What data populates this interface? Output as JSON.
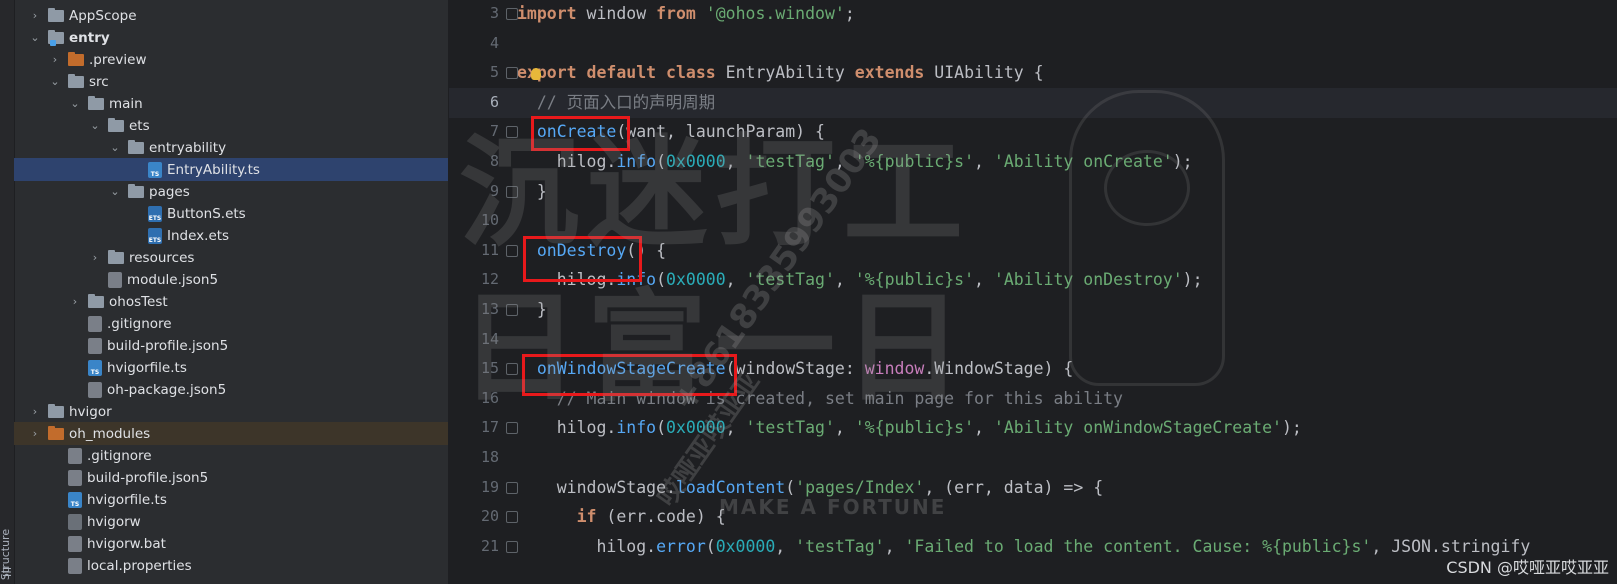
{
  "side_stripe": {
    "label": "Structure",
    "icon": "structure-icon"
  },
  "tree": [
    {
      "label": "AppScope",
      "kind": "folder",
      "depth": 1,
      "expand": "collapsed"
    },
    {
      "label": "entry",
      "kind": "folder-mod",
      "depth": 1,
      "expand": "expanded",
      "bold": true
    },
    {
      "label": ".preview",
      "kind": "folder-orange",
      "depth": 2,
      "expand": "collapsed"
    },
    {
      "label": "src",
      "kind": "folder",
      "depth": 2,
      "expand": "expanded"
    },
    {
      "label": "main",
      "kind": "folder",
      "depth": 3,
      "expand": "expanded"
    },
    {
      "label": "ets",
      "kind": "folder",
      "depth": 4,
      "expand": "expanded"
    },
    {
      "label": "entryability",
      "kind": "folder",
      "depth": 5,
      "expand": "expanded"
    },
    {
      "label": "EntryAbility.ts",
      "kind": "ts",
      "depth": 6,
      "expand": "none",
      "selected": true
    },
    {
      "label": "pages",
      "kind": "folder",
      "depth": 5,
      "expand": "expanded"
    },
    {
      "label": "ButtonS.ets",
      "kind": "ets",
      "depth": 6,
      "expand": "none"
    },
    {
      "label": "Index.ets",
      "kind": "ets",
      "depth": 6,
      "expand": "none"
    },
    {
      "label": "resources",
      "kind": "folder",
      "depth": 4,
      "expand": "collapsed"
    },
    {
      "label": "module.json5",
      "kind": "json",
      "depth": 4,
      "expand": "none"
    },
    {
      "label": "ohosTest",
      "kind": "folder",
      "depth": 3,
      "expand": "collapsed"
    },
    {
      "label": ".gitignore",
      "kind": "git",
      "depth": 3,
      "expand": "none"
    },
    {
      "label": "build-profile.json5",
      "kind": "json",
      "depth": 3,
      "expand": "none"
    },
    {
      "label": "hvigorfile.ts",
      "kind": "ts",
      "depth": 3,
      "expand": "none"
    },
    {
      "label": "oh-package.json5",
      "kind": "json",
      "depth": 3,
      "expand": "none"
    },
    {
      "label": "hvigor",
      "kind": "folder",
      "depth": 1,
      "expand": "collapsed"
    },
    {
      "label": "oh_modules",
      "kind": "folder-orange",
      "depth": 1,
      "expand": "collapsed",
      "highlight": true
    },
    {
      "label": ".gitignore",
      "kind": "git",
      "depth": 2,
      "expand": "none"
    },
    {
      "label": "build-profile.json5",
      "kind": "json",
      "depth": 2,
      "expand": "none"
    },
    {
      "label": "hvigorfile.ts",
      "kind": "ts",
      "depth": 2,
      "expand": "none"
    },
    {
      "label": "hvigorw",
      "kind": "sh",
      "depth": 2,
      "expand": "none"
    },
    {
      "label": "hvigorw.bat",
      "kind": "json",
      "depth": 2,
      "expand": "none"
    },
    {
      "label": "local.properties",
      "kind": "json",
      "depth": 2,
      "expand": "none"
    }
  ],
  "code": [
    {
      "n": "3",
      "t": [
        [
          "kw",
          "import"
        ],
        [
          "p",
          " window "
        ],
        [
          "kw",
          "from"
        ],
        [
          "p",
          " "
        ],
        [
          "str",
          "'@ohos.window'"
        ],
        [
          "p",
          ";"
        ]
      ]
    },
    {
      "n": "4",
      "t": []
    },
    {
      "n": "5",
      "t": [
        [
          "kw",
          "export"
        ],
        [
          "p",
          " "
        ],
        [
          "kw",
          "default"
        ],
        [
          "p",
          " "
        ],
        [
          "kw",
          "class"
        ],
        [
          "p",
          " "
        ],
        [
          "cls",
          "EntryAbility"
        ],
        [
          "p",
          " "
        ],
        [
          "kw",
          "extends"
        ],
        [
          "p",
          " "
        ],
        [
          "cls",
          "UIAbility"
        ],
        [
          "p",
          " {"
        ]
      ]
    },
    {
      "n": "6",
      "t": [
        [
          "p",
          "  "
        ],
        [
          "cmt",
          "// 页面入口的声明周期"
        ]
      ],
      "current": true
    },
    {
      "n": "7",
      "t": [
        [
          "p",
          "  "
        ],
        [
          "fn",
          "onCreate"
        ],
        [
          "p",
          "(want, launchParam) {"
        ]
      ]
    },
    {
      "n": "8",
      "t": [
        [
          "p",
          "    hilog."
        ],
        [
          "fn",
          "info"
        ],
        [
          "p",
          "("
        ],
        [
          "num",
          "0x0000"
        ],
        [
          "p",
          ", "
        ],
        [
          "str",
          "'testTag'"
        ],
        [
          "p",
          ", "
        ],
        [
          "str",
          "'%{public}s'"
        ],
        [
          "p",
          ", "
        ],
        [
          "str",
          "'Ability onCreate'"
        ],
        [
          "p",
          ");"
        ]
      ]
    },
    {
      "n": "9",
      "t": [
        [
          "p",
          "  }"
        ]
      ]
    },
    {
      "n": "10",
      "t": []
    },
    {
      "n": "11",
      "t": [
        [
          "p",
          "  "
        ],
        [
          "fn",
          "onDestroy"
        ],
        [
          "p",
          "() {"
        ]
      ]
    },
    {
      "n": "12",
      "t": [
        [
          "p",
          "    hilog."
        ],
        [
          "fn",
          "info"
        ],
        [
          "p",
          "("
        ],
        [
          "num",
          "0x0000"
        ],
        [
          "p",
          ", "
        ],
        [
          "str",
          "'testTag'"
        ],
        [
          "p",
          ", "
        ],
        [
          "str",
          "'%{public}s'"
        ],
        [
          "p",
          ", "
        ],
        [
          "str",
          "'Ability onDestroy'"
        ],
        [
          "p",
          ");"
        ]
      ]
    },
    {
      "n": "13",
      "t": [
        [
          "p",
          "  }"
        ]
      ]
    },
    {
      "n": "14",
      "t": []
    },
    {
      "n": "15",
      "t": [
        [
          "p",
          "  "
        ],
        [
          "fn",
          "onWindowStageCreate"
        ],
        [
          "p",
          "(windowStage: "
        ],
        [
          "type",
          "window"
        ],
        [
          "p",
          "."
        ],
        [
          "cls",
          "WindowStage"
        ],
        [
          "p",
          ") {"
        ]
      ]
    },
    {
      "n": "16",
      "t": [
        [
          "p",
          "    "
        ],
        [
          "cmt",
          "// Main window is created, set main page for this ability"
        ]
      ]
    },
    {
      "n": "17",
      "t": [
        [
          "p",
          "    hilog."
        ],
        [
          "fn",
          "info"
        ],
        [
          "p",
          "("
        ],
        [
          "num",
          "0x0000"
        ],
        [
          "p",
          ", "
        ],
        [
          "str",
          "'testTag'"
        ],
        [
          "p",
          ", "
        ],
        [
          "str",
          "'%{public}s'"
        ],
        [
          "p",
          ", "
        ],
        [
          "str",
          "'Ability onWindowStageCreate'"
        ],
        [
          "p",
          ");"
        ]
      ]
    },
    {
      "n": "18",
      "t": []
    },
    {
      "n": "19",
      "t": [
        [
          "p",
          "    windowStage."
        ],
        [
          "fn",
          "loadContent"
        ],
        [
          "p",
          "("
        ],
        [
          "str",
          "'pages/Index'"
        ],
        [
          "p",
          ", (err, data) => {"
        ]
      ]
    },
    {
      "n": "20",
      "t": [
        [
          "p",
          "      "
        ],
        [
          "kw",
          "if"
        ],
        [
          "p",
          " (err.code) {"
        ]
      ]
    },
    {
      "n": "21",
      "t": [
        [
          "p",
          "        hilog."
        ],
        [
          "fn",
          "error"
        ],
        [
          "p",
          "("
        ],
        [
          "num",
          "0x0000"
        ],
        [
          "p",
          ", "
        ],
        [
          "str",
          "'testTag'"
        ],
        [
          "p",
          ", "
        ],
        [
          "str",
          "'Failed to load the content. Cause: %{public}s'"
        ],
        [
          "p",
          ", JSON.stringify"
        ]
      ]
    }
  ],
  "watermark": {
    "big_line1": "沉迷打工",
    "big_line2": "日富一日",
    "phone": "+8618335993003",
    "name": "哎哑亚哎亚亚",
    "brand": "MAKE A FORTUNE"
  },
  "footer": "CSDN @哎哑亚哎亚亚"
}
